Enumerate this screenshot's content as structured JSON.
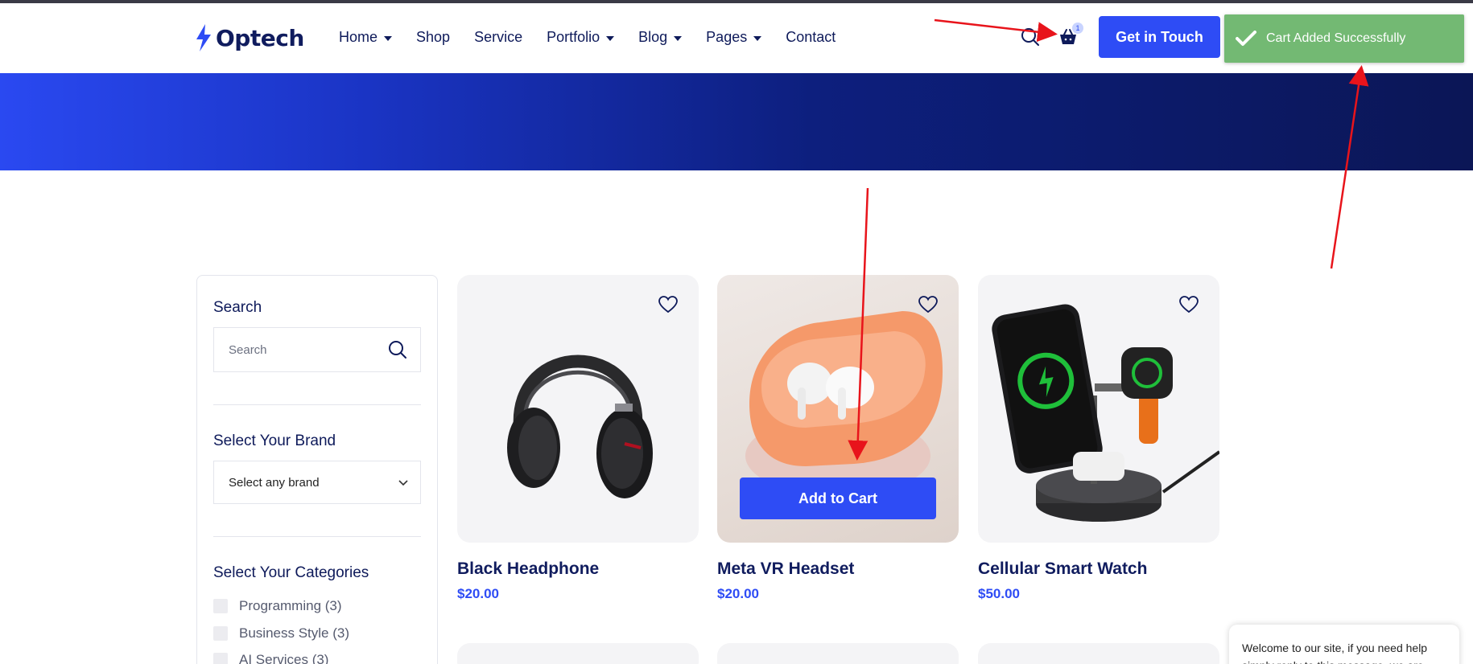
{
  "header": {
    "logo_text": "Optech",
    "nav": [
      {
        "label": "Home",
        "has_caret": true
      },
      {
        "label": "Shop",
        "has_caret": false
      },
      {
        "label": "Service",
        "has_caret": false
      },
      {
        "label": "Portfolio",
        "has_caret": true
      },
      {
        "label": "Blog",
        "has_caret": true
      },
      {
        "label": "Pages",
        "has_caret": true
      },
      {
        "label": "Contact",
        "has_caret": false
      }
    ],
    "search_icon": "search-icon",
    "cart_icon": "basket-icon",
    "cart_count": "1",
    "cta_label": "Get in Touch"
  },
  "toast": {
    "message": "Cart Added Successfully",
    "icon": "check-icon",
    "color": "#73b973"
  },
  "sidebar": {
    "search_title": "Search",
    "search_placeholder": "Search",
    "brand_title": "Select Your Brand",
    "brand_selected": "Select any brand",
    "categories_title": "Select Your Categories",
    "categories": [
      {
        "label": "Programming (3)"
      },
      {
        "label": "Business Style (3)"
      },
      {
        "label": "AI Services (3)"
      }
    ]
  },
  "products": [
    {
      "name": "Black Headphone",
      "price": "$20.00"
    },
    {
      "name": "Meta VR Headset",
      "price": "$20.00",
      "hover_button": "Add to Cart"
    },
    {
      "name": "Cellular Smart Watch",
      "price": "$50.00"
    }
  ],
  "chat": {
    "message": "Welcome to our site, if you need help simply reply to this message, we are online and ready to help."
  },
  "colors": {
    "brand_blue": "#2e4cf5",
    "navy": "#0e1a5a",
    "annotation": "#e8141b"
  }
}
